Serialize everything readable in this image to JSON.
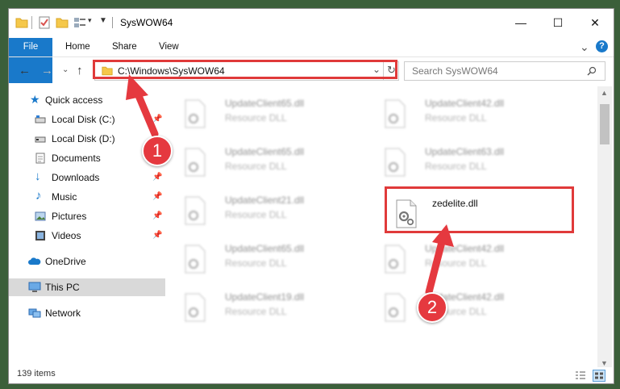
{
  "window": {
    "title": "SysWOW64",
    "controls": {
      "minimize": "—",
      "maximize": "☐",
      "close": "✕"
    }
  },
  "ribbon": {
    "tabs": [
      "File",
      "Home",
      "Share",
      "View"
    ],
    "collapse": "⌄",
    "help": "?"
  },
  "address": {
    "path": "C:\\Windows\\SysWOW64",
    "dropdown": "⌄",
    "refresh": "↻"
  },
  "search": {
    "placeholder": "Search SysWOW64"
  },
  "nav": {
    "items": [
      {
        "label": "Quick access",
        "icon": "star-icon"
      },
      {
        "label": "Local Disk (C:)",
        "icon": "drive-icon",
        "pinned": true
      },
      {
        "label": "Local Disk (D:)",
        "icon": "drive-icon"
      },
      {
        "label": "Documents",
        "icon": "documents-icon",
        "pinned": true
      },
      {
        "label": "Downloads",
        "icon": "download-icon",
        "pinned": true
      },
      {
        "label": "Music",
        "icon": "music-icon",
        "pinned": true
      },
      {
        "label": "Pictures",
        "icon": "pictures-icon",
        "pinned": true
      },
      {
        "label": "Videos",
        "icon": "videos-icon",
        "pinned": true
      },
      {
        "label": "OneDrive",
        "icon": "cloud-icon"
      },
      {
        "label": "This PC",
        "icon": "pc-icon",
        "selected": true
      },
      {
        "label": "Network",
        "icon": "network-icon"
      }
    ]
  },
  "files": [
    {
      "name": "UpdateClient65.dll",
      "type": "Resource DLL"
    },
    {
      "name": "UpdateClient42.dll",
      "type": "Resource DLL"
    },
    {
      "name": "UpdateClient65.dll",
      "type": "Resource DLL"
    },
    {
      "name": "UpdateClient63.dll",
      "type": "Resource DLL"
    },
    {
      "name": "UpdateClient21.dll",
      "type": "Resource DLL"
    },
    {
      "name": "zedelite.dll",
      "type": ""
    },
    {
      "name": "UpdateClient65.dll",
      "type": "Resource DLL"
    },
    {
      "name": "UpdateClient42.dll",
      "type": "Resource DLL"
    },
    {
      "name": "UpdateClient19.dll",
      "type": "Resource DLL"
    },
    {
      "name": "UpdateClient42.dll",
      "type": "Resource DLL"
    }
  ],
  "status": {
    "item_count": "139 items"
  },
  "annotations": {
    "step1": "1",
    "step2": "2",
    "color": "#e5393f"
  }
}
